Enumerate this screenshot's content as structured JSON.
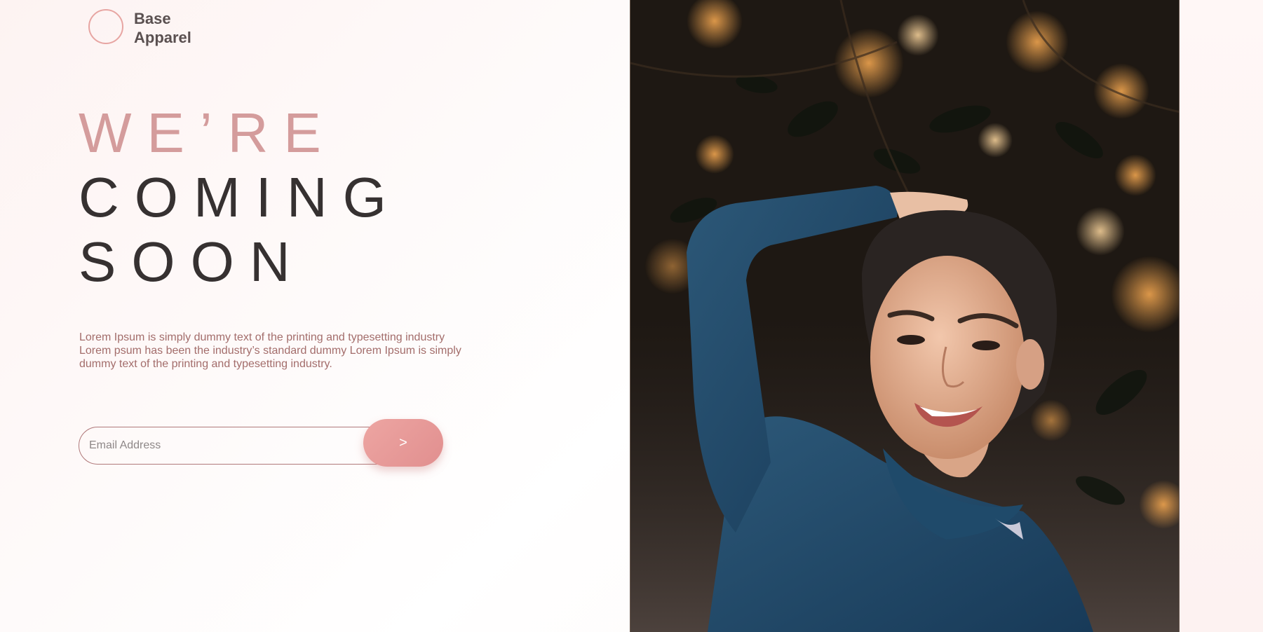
{
  "brand": {
    "line1": "Base",
    "line2": "Apparel"
  },
  "hero": {
    "headline_light": "WE’RE",
    "headline_line2": "COMING",
    "headline_line3": "SOON",
    "description": "Lorem Ipsum is simply dummy text of the printing and typesetting industry Lorem psum has been the industry’s standard dummy Lorem Ipsum is simply dummy text of the printing and typesetting industry."
  },
  "signup": {
    "email_placeholder": "Email Address",
    "submit_label": ">"
  },
  "colors": {
    "accent": "#e7a5a2",
    "headline_light": "#d49c9c",
    "headline_dark": "#363131",
    "description": "#a36d6b"
  }
}
